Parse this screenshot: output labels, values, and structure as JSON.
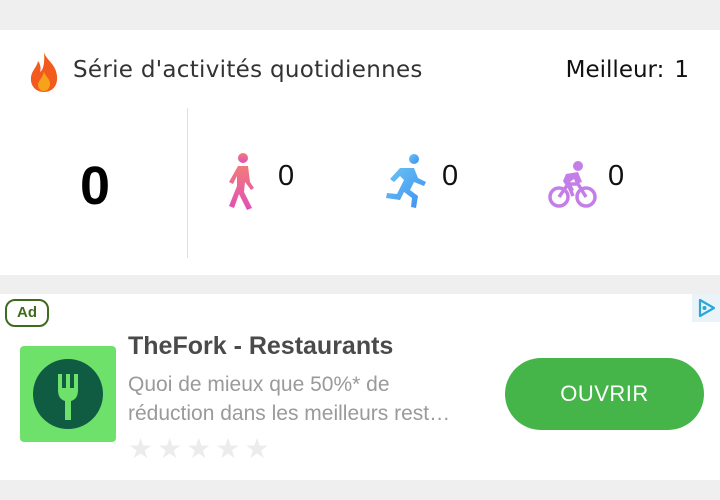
{
  "streak": {
    "title": "Série d'activités quotidiennes",
    "best_label": "Meilleur:",
    "best_value": "1",
    "count": "0",
    "icon": "flame-icon",
    "activities": [
      {
        "icon": "walking-icon",
        "value": "0",
        "color": "#ea5fa6"
      },
      {
        "icon": "running-icon",
        "value": "0",
        "color": "#4aa8f0"
      },
      {
        "icon": "cycling-icon",
        "value": "0",
        "color": "#c47ee8"
      }
    ]
  },
  "ad": {
    "badge": "Ad",
    "title": "TheFork - Restaurants",
    "description_line1": "Quoi de mieux que 50%* de",
    "description_line2": "réduction dans les meilleurs rest…",
    "cta": "OUVRIR",
    "rating_stars": 5,
    "colors": {
      "icon_bg": "#6ee16a",
      "icon_fg": "#0f5c43",
      "cta_bg": "#45b549",
      "badge": "#3f6b1f"
    }
  }
}
